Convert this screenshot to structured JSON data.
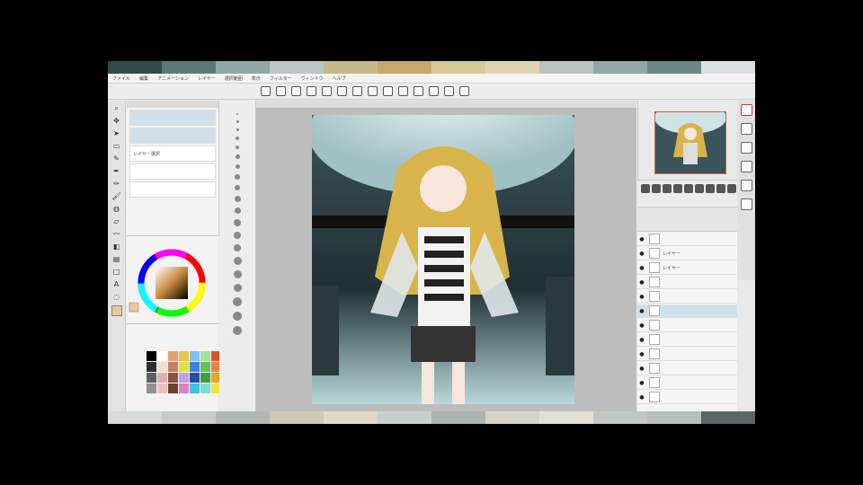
{
  "menubar": {
    "items": [
      "ファイル",
      "編集",
      "アニメーション",
      "レイヤー",
      "選択範囲",
      "表示",
      "フィルター",
      "ウィンドウ",
      "ヘルプ"
    ]
  },
  "canvas": {
    "tab_label": ""
  },
  "subtool": {
    "items": [
      {
        "label": "",
        "selected": true
      },
      {
        "label": "",
        "selected": true
      },
      {
        "label": "レイヤー選択",
        "selected": false
      },
      {
        "label": "",
        "selected": false
      },
      {
        "label": "",
        "selected": false
      }
    ]
  },
  "colors": {
    "accent": "#d06060",
    "selection": "#cfe0ea",
    "palette": [
      "#000000",
      "#ffffff",
      "#e8a070",
      "#f0c040",
      "#80c0f0",
      "#a0e0a0",
      "#e05030",
      "#303030",
      "#f0e0d0",
      "#c08060",
      "#e0e040",
      "#4080e0",
      "#60c060",
      "#f08040",
      "#606060",
      "#e0b0b0",
      "#905040",
      "#c0a0e0",
      "#2050a0",
      "#40a040",
      "#f0a020",
      "#909090",
      "#f0c0c0",
      "#704030",
      "#e080c0",
      "#40c0e0",
      "#80e0d0",
      "#f0e040"
    ]
  },
  "layers": {
    "rows": [
      {
        "label": "",
        "selected": false
      },
      {
        "label": "レイヤー",
        "selected": false
      },
      {
        "label": "レイヤー",
        "selected": false
      },
      {
        "label": "",
        "selected": false
      },
      {
        "label": "",
        "selected": false
      },
      {
        "label": "",
        "selected": true
      },
      {
        "label": "",
        "selected": false
      },
      {
        "label": "",
        "selected": false
      },
      {
        "label": "",
        "selected": false
      },
      {
        "label": "",
        "selected": false
      },
      {
        "label": "",
        "selected": false
      },
      {
        "label": "",
        "selected": false
      }
    ]
  }
}
